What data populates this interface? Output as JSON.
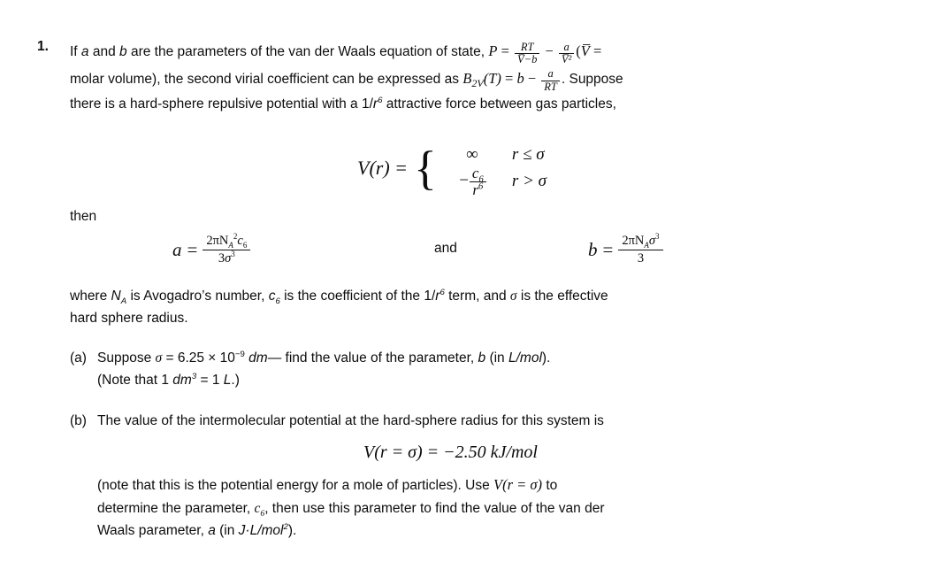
{
  "document": {
    "type": "physical-chemistry-problem",
    "problem_number": "1.",
    "intro": {
      "seg1": "If ",
      "var_a": "a",
      "seg2": " and ",
      "var_b": "b",
      "seg3": " are the parameters of the van der Waals equation of state, ",
      "eq_P_lhs": "P",
      "eq_equals": "=",
      "frac1_num": "RT",
      "frac1_den": "V̅−b",
      "minus": "−",
      "frac2_num": "a",
      "frac2_den": "V̅²",
      "paren_open": "(",
      "Vbar": "V̅",
      "trailing_equals": "="
    },
    "line2": {
      "seg1": "molar volume), the second virial coefficient can be expressed as ",
      "eq_B_lhs": "B",
      "eq_B_sub": "2V",
      "eq_B_arg": "(T)",
      "eq_B_equals": "=",
      "eq_B_b": "b",
      "eq_B_minus": "−",
      "frac_num": "a",
      "frac_den": "RT",
      "period": ".",
      "seg2": " Suppose"
    },
    "line3": {
      "seg1": "there is a hard-sphere repulsive potential with a 1/",
      "r_italic": "r",
      "exp6": "6",
      "seg2": " attractive force between gas particles,"
    },
    "piecewise": {
      "lhs": "V(r) =",
      "row1_value": "∞",
      "row1_condition": "r ≤ σ",
      "row2_minus": "−",
      "row2_num": "c",
      "row2_num_sub": "6",
      "row2_den": "r",
      "row2_den_sup": "6",
      "row2_condition": "r > σ"
    },
    "then_label": "then",
    "equation_a": {
      "lhs": "a",
      "equals": "=",
      "num_prefix": "2πN",
      "num_sub": "A",
      "num_sup": "2",
      "num_c": "c",
      "num_c_sub": "6",
      "den_num": "3",
      "den_sigma": "σ",
      "den_sup": "3"
    },
    "and_label": "and",
    "equation_b": {
      "lhs": "b",
      "equals": "=",
      "num_prefix": "2πN",
      "num_sub": "A",
      "num_sigma": "σ",
      "num_sup": "3",
      "den": "3"
    },
    "where_para": {
      "seg1": "where ",
      "NA": "N",
      "NA_sub": "A",
      "seg2": " is Avogadro’s number, ",
      "c6": "c",
      "c6_sub": "6",
      "seg3": " is the coefficient of the 1/",
      "r": "r",
      "r_sup": "6",
      "seg4": " term, and ",
      "sigma": "σ",
      "seg5": " is the effective",
      "line2": "hard sphere radius."
    },
    "part_a": {
      "label": "(a)",
      "seg1": " Suppose ",
      "sigma": "σ",
      "seg2": " = 6.25 × 10",
      "exp": "−9",
      "units": " dm",
      "seg3": "— find the value of the parameter, ",
      "var_b": "b",
      "seg4": " (in ",
      "unit_b": "L/mol",
      "seg5": ").",
      "note_seg1": "(Note that 1 ",
      "note_dm": "dm",
      "note_sup": "3",
      "note_seg2": " = 1 ",
      "note_L": "L",
      "note_seg3": ".)"
    },
    "part_b": {
      "label": "(b)",
      "seg1": " The value of the intermolecular potential at the hard-sphere radius for this system is",
      "display_eq": "V(r = σ) = −2.50 kJ/mol",
      "seg2": "(note that this is the potential energy for a mole of particles). Use ",
      "Vrsigma": "V(r = σ)",
      "seg3": " to",
      "seg4": "determine the parameter, ",
      "c6": "c",
      "c6_sub": "6",
      "seg5": ", then use this parameter to find the value of the van der",
      "seg6": "Waals parameter, ",
      "var_a": "a",
      "seg7": " (in ",
      "unit_a": "J·L/mol",
      "unit_a_sup": "2",
      "seg8": ")."
    }
  },
  "colors": {
    "text": "#0d0d0d",
    "background": "#ffffff"
  }
}
